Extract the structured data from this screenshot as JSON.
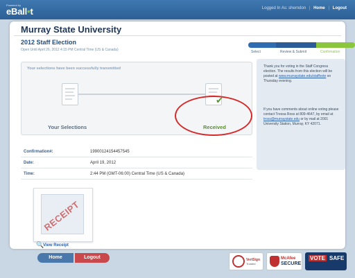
{
  "topbar": {
    "powered_by": "Powered by",
    "brand_pre": "eBall",
    "brand_mid": "•",
    "brand_post": "t",
    "logged_in_as": "Logged In As: sherndon",
    "home_link": "Home",
    "logout_link": "Logout"
  },
  "header": {
    "organization": "Murray State University",
    "election_title": "2012 Staff Election",
    "election_subtitle": "Open Until April 26, 2012 4:15 PM Central Time (US & Canada)"
  },
  "steps": {
    "labels": [
      "Select",
      "Review & Submit",
      "Confirmation"
    ],
    "active_index": 2,
    "colors": {
      "done": "#2f6db0",
      "active": "#8cc63f"
    }
  },
  "progress": {
    "message": "Your selections have been successfully transmitted",
    "left_label": "Your Selections",
    "right_label": "Received"
  },
  "sidebar": {
    "paragraph1_pre": "Thank you for voting in the Staff Congress election. The results from this election will be posted at",
    "paragraph1_link": "www.murraystate.edu/staffvote",
    "paragraph1_post": "on Thursday evening.",
    "paragraph2_pre": "If you have comments about online voting please contact Tressa Ross at 809-4647, by email at",
    "paragraph2_link": "tross@murraystate.edu",
    "paragraph2_post": "or by mail at 2001 University Station, Murray, KY 42071."
  },
  "confirmation": {
    "rows": [
      {
        "label": "Confirmation#:",
        "value": "19900124154457545"
      },
      {
        "label": "Date:",
        "value": "April 19, 2012"
      },
      {
        "label": "Time:",
        "value": "2:44 PM (GMT-06:00) Central Time (US & Canada)"
      }
    ]
  },
  "receipt": {
    "stamp": "RECEIPT",
    "view_label": "View Receipt"
  },
  "buttons": {
    "home": "Home",
    "logout": "Logout"
  },
  "badges": {
    "verisign_line1": "VeriSign",
    "verisign_line2": "Trusted",
    "mcafee_line1": "McAfee",
    "mcafee_line2": "SECURE",
    "votesafe_line1": "VOTE",
    "votesafe_line2": "SAFE"
  },
  "colors": {
    "brand_blue": "#2c5f95",
    "brand_green": "#7fc242",
    "home_button": "#4a78aa",
    "logout_button": "#c9484b",
    "highlight_ring": "#d52a2a"
  }
}
